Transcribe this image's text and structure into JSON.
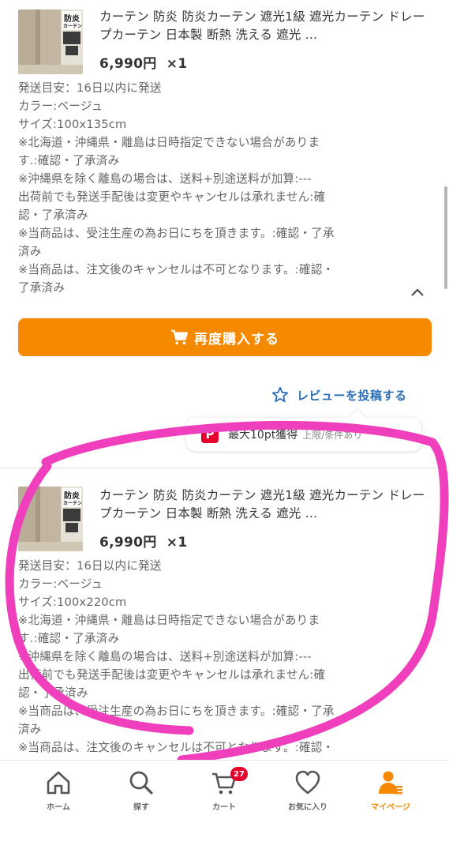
{
  "products": [
    {
      "title": "カーテン 防炎 防炎カーテン 遮光1級 遮光カーテン ドレープカーテン 日本製 断熱 洗える 遮光 …",
      "price": "6,990円",
      "qty": "×1",
      "thumb_text_1": "防炎",
      "thumb_text_2": "カーテン",
      "details": [
        "発送目安：16日以内に発送",
        "カラー:ベージュ",
        "サイズ:100x135cm",
        "※北海道・沖縄県・離島は日時指定できない場合がありま",
        "す.:確認・了承済み",
        "※沖縄県を除く離島の場合は、送料+別途送料が加算:---",
        "出荷前でも発送手配後は変更やキャンセルは承れません:確",
        "認・了承済み",
        "※当商品は、受注生産の為お日にちを頂きます。:確認・了承",
        "済み",
        "※当商品は、注文後のキャンセルは不可となります。:確認・",
        "了承済み"
      ]
    },
    {
      "title": "カーテン 防炎 防炎カーテン 遮光1級 遮光カーテン ドレープカーテン 日本製 断熱 洗える 遮光 …",
      "price": "6,990円",
      "qty": "×1",
      "thumb_text_1": "防炎",
      "thumb_text_2": "カーテン",
      "details": [
        "発送目安：16日以内に発送",
        "カラー:ベージュ",
        "サイズ:100x220cm",
        "※北海道・沖縄県・離島は日時指定できない場合がありま",
        "す.:確認・了承済み",
        "※沖縄県を除く離島の場合は、送料+別途送料が加算:---",
        "出荷前でも発送手配後は変更やキャンセルは承れません:確",
        "認・了承済み",
        "※当商品は、受注生産の為お日にちを頂きます。:確認・了承",
        "済み",
        "※当商品は、注文後のキャンセルは不可となります。:確認・"
      ]
    }
  ],
  "actions": {
    "rebuy_label": "再度購入する",
    "review_label": "レビューを投稿する"
  },
  "points_tip": {
    "icon_letter": "P",
    "text": "最大10pt獲得",
    "note": "上限/条件あり"
  },
  "nav": {
    "items": [
      {
        "label": "ホーム",
        "icon": "home-icon"
      },
      {
        "label": "探す",
        "icon": "search-icon"
      },
      {
        "label": "カート",
        "icon": "cart-icon"
      },
      {
        "label": "お気に入り",
        "icon": "heart-icon"
      },
      {
        "label": "マイページ",
        "icon": "user-icon"
      }
    ],
    "cart_badge": "27",
    "active_index": 4
  },
  "colors": {
    "accent": "#f58a00",
    "link": "#2a6fb5",
    "badge": "#e4002b",
    "marker": "#ef3fbd"
  }
}
